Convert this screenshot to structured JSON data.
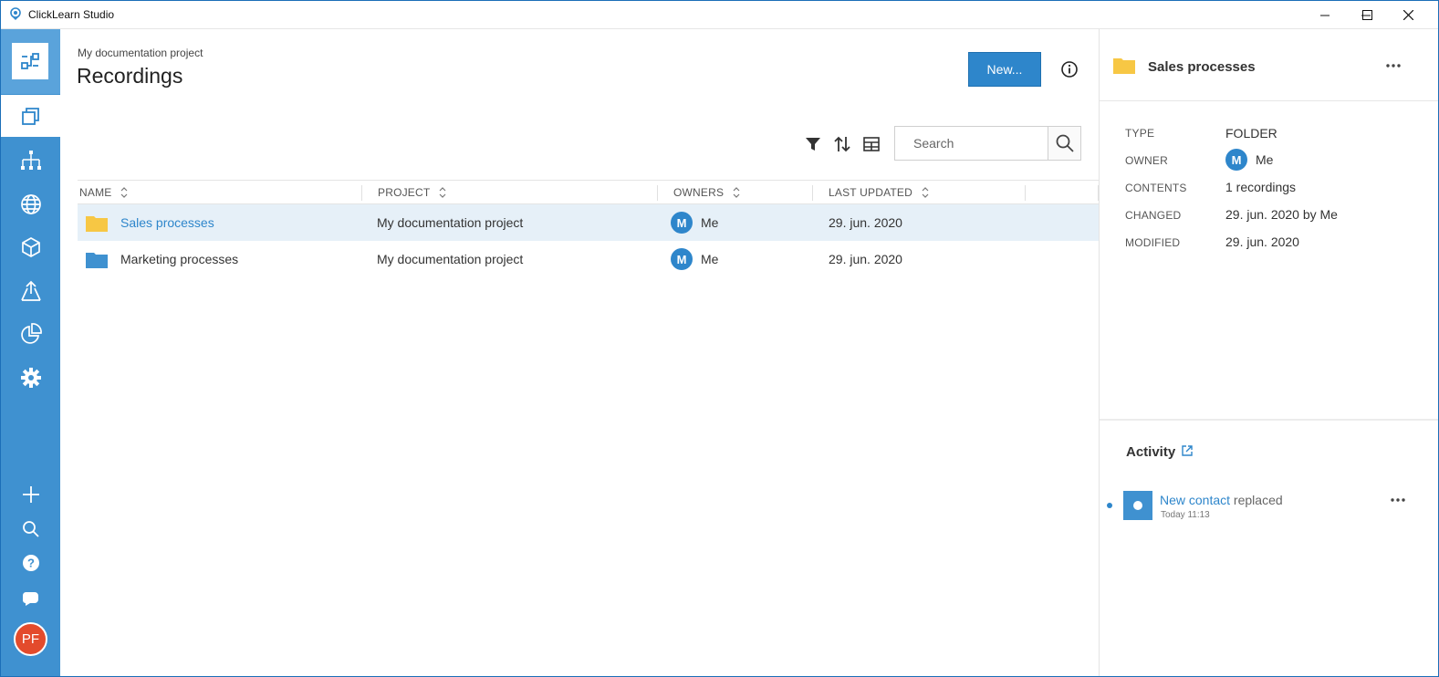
{
  "window": {
    "title": "ClickLearn Studio"
  },
  "sidebar": {
    "items": [
      {
        "icon": "recordings-icon",
        "active": true
      },
      {
        "icon": "sitemap-icon"
      },
      {
        "icon": "globe-icon"
      },
      {
        "icon": "package-icon"
      },
      {
        "icon": "publish-icon"
      },
      {
        "icon": "chart-icon"
      },
      {
        "icon": "settings-icon"
      }
    ],
    "bottom_items": [
      "add-icon",
      "search-icon",
      "help-icon",
      "chat-icon"
    ],
    "user_initials": "PF",
    "colors": {
      "background": "#3f91d0",
      "logo_bg": "#5aa3db",
      "avatar": "#e34b2c"
    }
  },
  "header": {
    "breadcrumb": "My documentation project",
    "title": "Recordings",
    "new_button": "New..."
  },
  "toolbar": {
    "search_placeholder": "Search"
  },
  "table": {
    "columns": [
      "NAME",
      "PROJECT",
      "OWNERS",
      "LAST UPDATED"
    ],
    "rows": [
      {
        "name": "Sales processes",
        "project": "My documentation project",
        "owner_initial": "M",
        "owner": "Me",
        "updated": "29. jun. 2020",
        "folder_color": "#f7c744",
        "selected": true
      },
      {
        "name": "Marketing processes",
        "project": "My documentation project",
        "owner_initial": "M",
        "owner": "Me",
        "updated": "29. jun. 2020",
        "folder_color": "#3f91d0",
        "selected": false
      }
    ]
  },
  "details": {
    "title": "Sales processes",
    "properties": {
      "type_label": "TYPE",
      "type_value": "FOLDER",
      "owner_label": "OWNER",
      "owner_initial": "M",
      "owner_value": "Me",
      "contents_label": "CONTENTS",
      "contents_value": "1 recordings",
      "changed_label": "CHANGED",
      "changed_value": "29. jun. 2020 by Me",
      "modified_label": "MODIFIED",
      "modified_value": "29. jun. 2020"
    },
    "activity": {
      "title": "Activity",
      "items": [
        {
          "link": "New contact",
          "text": " replaced",
          "time": "Today 11:13"
        }
      ]
    }
  },
  "colors": {
    "accent": "#2e86cb",
    "selected_row": "#e6f0f8"
  }
}
